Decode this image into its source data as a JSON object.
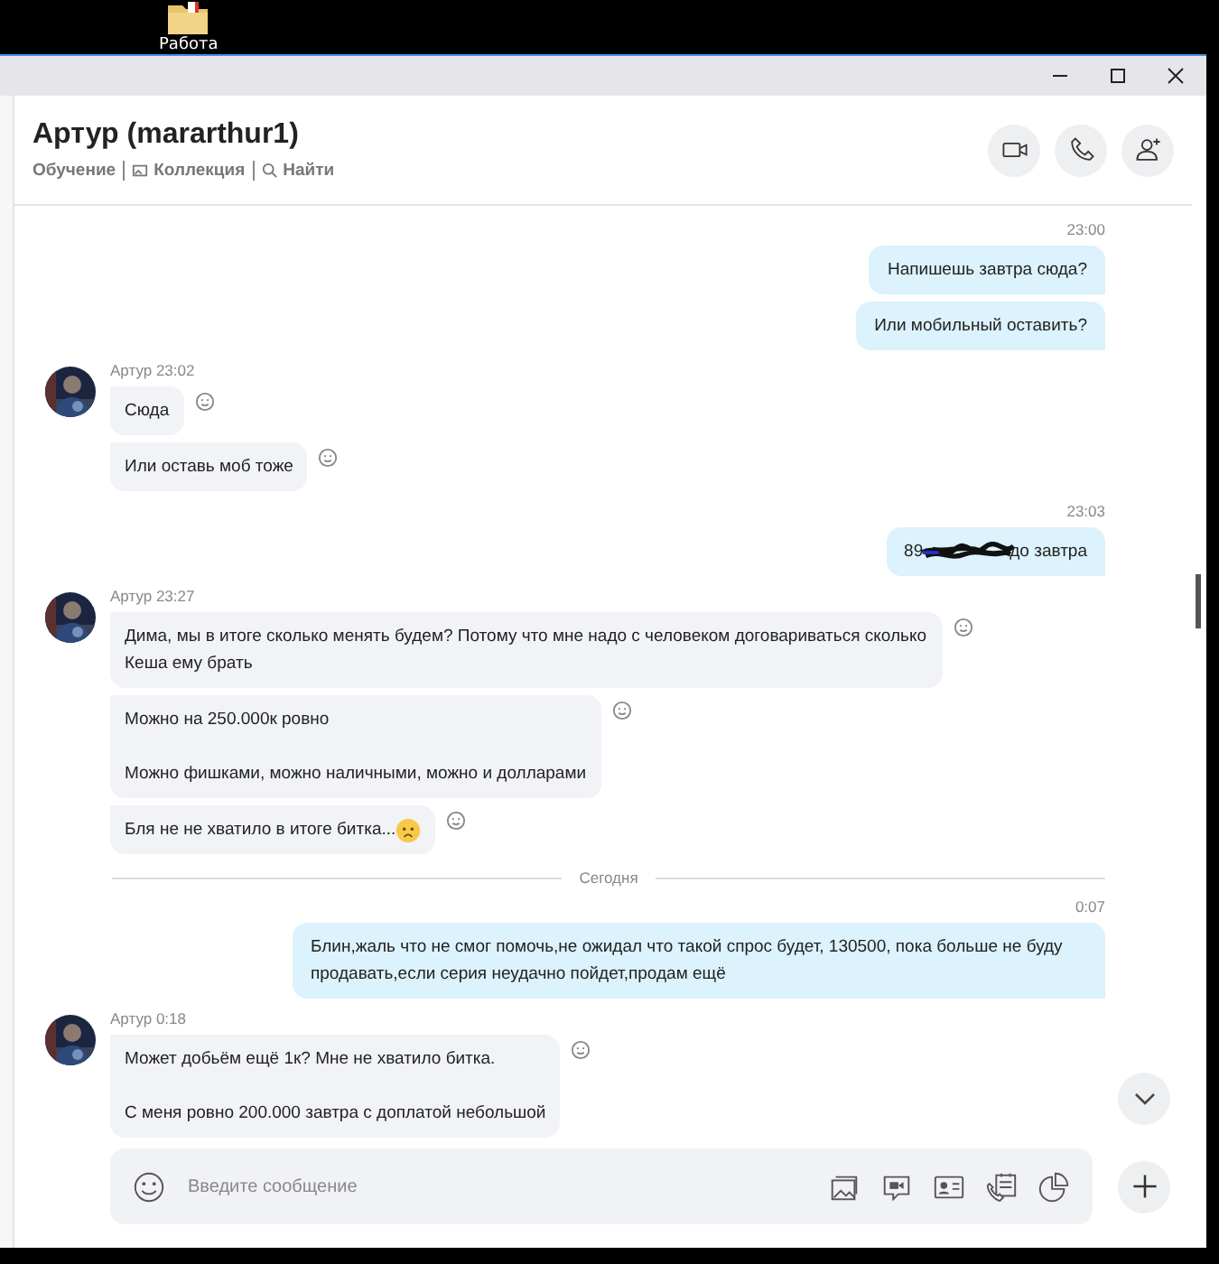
{
  "desktop": {
    "folder_label": "Работа"
  },
  "header": {
    "title": "Артур (mararthur1)",
    "links": [
      {
        "label": "Обучение",
        "kind": "plain"
      },
      {
        "label": "Коллекция",
        "kind": "gallery"
      },
      {
        "label": "Найти",
        "kind": "search"
      }
    ]
  },
  "chat": {
    "items": [
      {
        "kind": "sent",
        "time": "23:00",
        "bubbles": [
          {
            "text": "Напишешь завтра сюда?"
          },
          {
            "text": "Или мобильный оставить?"
          }
        ]
      },
      {
        "kind": "received",
        "author": "Артур",
        "time": "23:02",
        "bubbles": [
          {
            "text": "Сюда"
          },
          {
            "text": "Или оставь моб тоже"
          }
        ]
      },
      {
        "kind": "sent",
        "time": "23:03",
        "bubbles": [
          {
            "text": "89",
            "redacted": true,
            "text_after": "до завтра"
          }
        ]
      },
      {
        "kind": "received",
        "author": "Артур",
        "time": "23:27",
        "bubbles": [
          {
            "text": "Дима, мы в итоге сколько менять будем? Потому что мне надо с человеком договариваться сколько Кеша ему брать"
          },
          {
            "text": " Можно на 250.000к ровно\n\nМожно фишками, можно наличными, можно и долларами"
          },
          {
            "text": "Бля не не хватило в итоге битка...",
            "has_emoji": true
          }
        ]
      },
      {
        "kind": "divider",
        "label": "Сегодня"
      },
      {
        "kind": "sent",
        "time": "0:07",
        "bubbles": [
          {
            "text": "Блин,жаль что не смог помочь,не ожидал что такой спрос будет, 130500, пока больше не буду продавать,если серия неудачно пойдет,продам ещё"
          }
        ]
      },
      {
        "kind": "received",
        "author": "Артур",
        "time": "0:18",
        "bubbles": [
          {
            "text": "Может добьём ещё 1к? Мне не хватило битка.\n\nС меня ровно 200.000 завтра с доплатой небольшой"
          }
        ]
      }
    ]
  },
  "composer": {
    "placeholder": "Введите сообщение"
  }
}
